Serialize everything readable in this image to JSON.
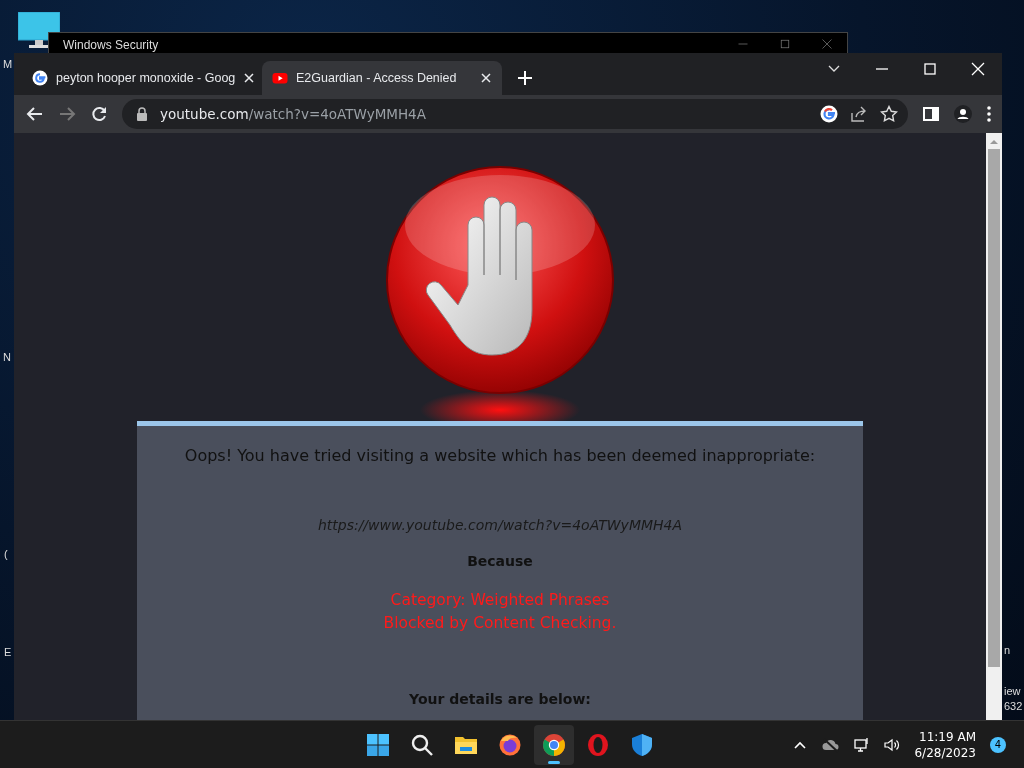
{
  "desktop": {
    "left_labels": [
      "M",
      "N",
      "(",
      "E"
    ],
    "right_labels": [
      "n",
      "iew",
      "632"
    ]
  },
  "background_window": {
    "title": "Windows Security"
  },
  "browser": {
    "tabs": [
      {
        "title": "peyton hooper monoxide - Goog",
        "selected": false,
        "kind": "google"
      },
      {
        "title": "E2Guardian - Access Denied",
        "selected": true,
        "kind": "youtube"
      }
    ],
    "address": {
      "domain": "youtube.com",
      "path": "/watch?v=4oATWyMMH4A"
    }
  },
  "page": {
    "heading": "Oops! You have tried visiting a website which has been deemed inappropriate:",
    "blocked_url": "https://www.youtube.com/watch?v=4oATWyMMH4A",
    "because": "Because",
    "reasons": [
      "Category: Weighted Phrases",
      "Blocked by Content Checking."
    ],
    "details_heading": "Your details are below:"
  },
  "taskbar": {
    "apps": [
      {
        "kind": "start",
        "selected": false
      },
      {
        "kind": "search",
        "selected": false
      },
      {
        "kind": "files",
        "selected": false
      },
      {
        "kind": "firefox",
        "selected": false
      },
      {
        "kind": "chrome",
        "selected": true
      },
      {
        "kind": "opera",
        "selected": false
      },
      {
        "kind": "defender",
        "selected": false
      }
    ],
    "time": "11:19 AM",
    "date": "6/28/2023",
    "notifications": "4"
  }
}
